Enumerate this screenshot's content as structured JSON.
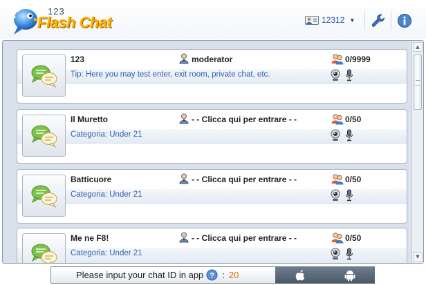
{
  "app": {
    "logo_number": "123",
    "logo_text": "Flash Chat"
  },
  "header": {
    "user_id": "12312",
    "icons": [
      "user-card-icon",
      "wrench-icon",
      "info-icon"
    ]
  },
  "rooms": [
    {
      "name": "123",
      "description": "Tip: Here you may test enter, exit room, private chat, etc.",
      "moderator": "moderator",
      "users": "0/9999"
    },
    {
      "name": "Il Muretto",
      "description": "Categoria: Under 21",
      "moderator": "- - Clicca qui per entrare - -",
      "users": "0/50"
    },
    {
      "name": "Batticuore",
      "description": "Categoria: Under 21",
      "moderator": "- - Clicca qui per entrare - -",
      "users": "0/50"
    },
    {
      "name": "Me ne F8!",
      "description": "Categoria: Under 21",
      "moderator": "- - Clicca qui per entrare - -",
      "users": "0/50"
    }
  ],
  "bottom_bar": {
    "prompt": "Please input your chat ID in app",
    "colon": ":",
    "chat_id": "20",
    "stores": [
      "apple-icon",
      "android-icon"
    ]
  },
  "colors": {
    "accent_blue": "#2a5fb0",
    "logo_orange": "#ffb000",
    "chat_id_orange": "#e07000"
  }
}
